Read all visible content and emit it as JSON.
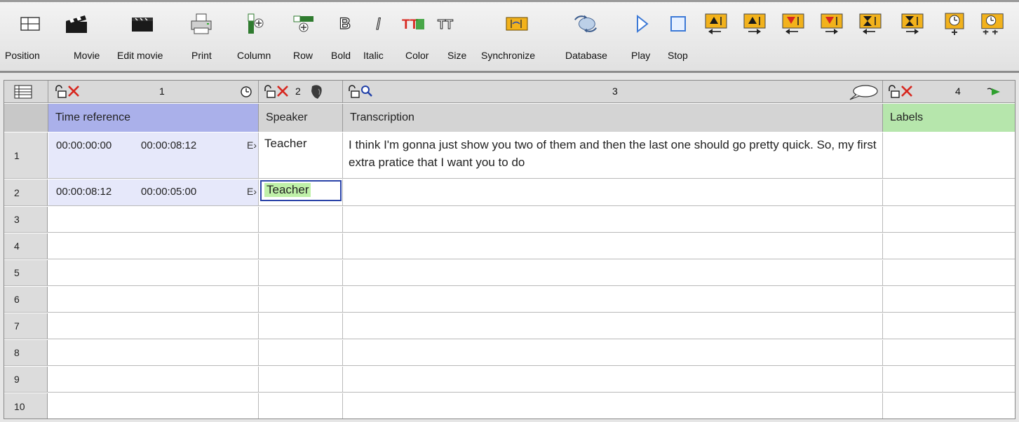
{
  "toolbar": {
    "labels": {
      "position": "Position",
      "movie": "Movie",
      "edit_movie": "Edit movie",
      "print": "Print",
      "column": "Column",
      "row": "Row",
      "bold": "Bold",
      "italic": "Italic",
      "color": "Color",
      "size": "Size",
      "synchronize": "Synchronize",
      "database": "Database",
      "play": "Play",
      "stop": "Stop"
    },
    "glyphs": {
      "bold": "B",
      "italic": "I",
      "color": "TT",
      "size": "TT"
    },
    "icons": [
      "position-icon",
      "movie-icon",
      "edit-movie-icon",
      "print-icon",
      "column-icon",
      "row-icon",
      "bold-icon",
      "italic-icon",
      "color-icon",
      "size-icon",
      "synchronize-icon",
      "database-icon",
      "play-icon",
      "stop-icon",
      "insert-before-left-icon",
      "insert-before-right-icon",
      "insert-after-left-icon",
      "insert-after-right-icon",
      "timeline-left-icon",
      "timeline-right-icon",
      "add-time-icon",
      "add-time-double-icon"
    ],
    "accent_colors": {
      "play": "#3c79d6",
      "stop": "#3c79d6",
      "orange": "#f2b21c",
      "red": "#d7271f"
    }
  },
  "grid": {
    "columns": [
      {
        "number": "1",
        "name": "Time reference",
        "header_color": "#aab0ea"
      },
      {
        "number": "2",
        "name": "Speaker",
        "header_color": "#d4d4d4"
      },
      {
        "number": "3",
        "name": "Transcription",
        "header_color": "#d4d4d4"
      },
      {
        "number": "4",
        "name": "Labels",
        "header_color": "#b6e6ac"
      }
    ],
    "time_cell_color": "#e6e8fa",
    "selection_color": "#2a43a8",
    "selection_fill": "#bff0a8",
    "rows": [
      {
        "number": "1",
        "time_start": "00:00:00:00",
        "time_duration": "00:00:08:12",
        "time_more": "E›",
        "speaker": "Teacher",
        "transcription": "I think I'm gonna just show you two of them and then the last one should go pretty quick. So, my first extra pratice that I want you to do",
        "labels": ""
      },
      {
        "number": "2",
        "time_start": "00:00:08:12",
        "time_duration": "00:00:05:00",
        "time_more": "E›",
        "speaker": "Teacher",
        "transcription": "",
        "labels": ""
      },
      {
        "number": "3"
      },
      {
        "number": "4"
      },
      {
        "number": "5"
      },
      {
        "number": "6"
      },
      {
        "number": "7"
      },
      {
        "number": "8"
      },
      {
        "number": "9"
      },
      {
        "number": "10"
      }
    ]
  }
}
